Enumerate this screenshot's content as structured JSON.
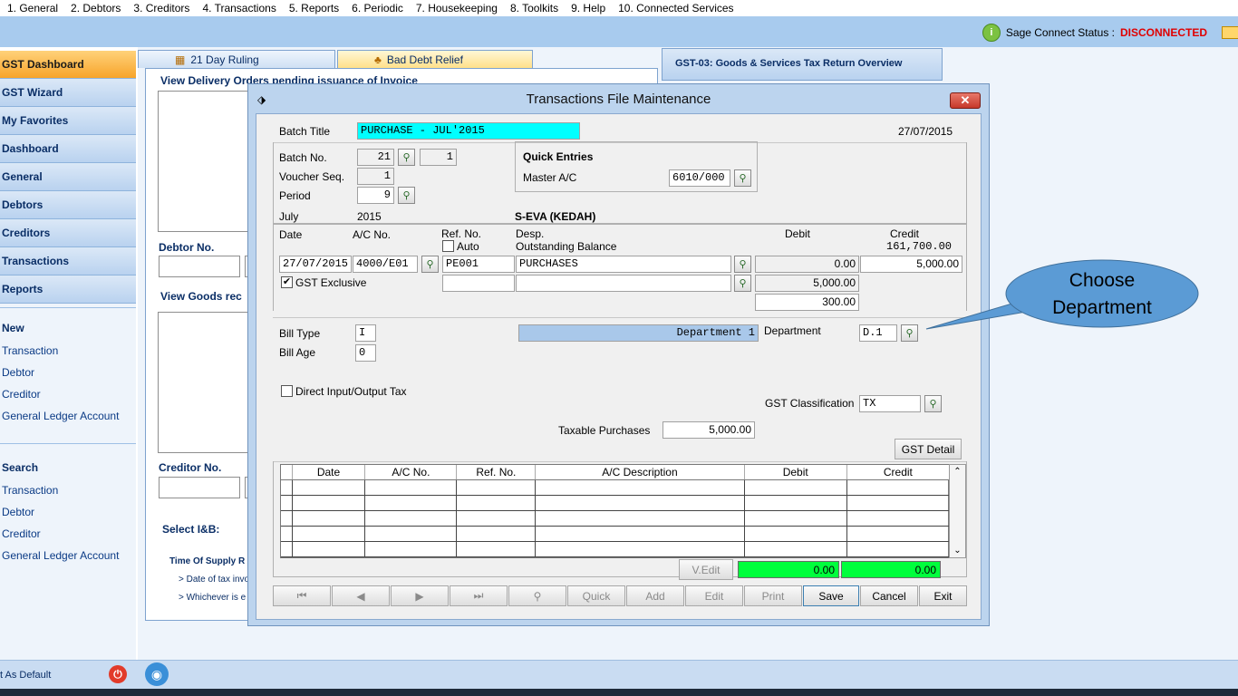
{
  "menu": [
    "1. General",
    "2. Debtors",
    "3. Creditors",
    "4. Transactions",
    "5. Reports",
    "6. Periodic",
    "7. Housekeeping",
    "8. Toolkits",
    "9. Help",
    "10. Connected Services"
  ],
  "connect": {
    "label": "Sage Connect Status :",
    "status": "DISCONNECTED"
  },
  "sidebar": {
    "buttons": [
      "GST Dashboard",
      "GST Wizard",
      "My Favorites",
      "Dashboard",
      "General",
      "Debtors",
      "Creditors",
      "Transactions",
      "Reports"
    ],
    "new_heading": "New",
    "new_links": [
      "Transaction",
      "Debtor",
      "Creditor",
      "General Ledger Account"
    ],
    "search_heading": "Search",
    "search_links": [
      "Transaction",
      "Debtor",
      "Creditor",
      "General Ledger Account"
    ],
    "set_default": "t As Default"
  },
  "background": {
    "tab1": "21 Day Ruling",
    "tab2": "Bad Debt Relief",
    "gst_box": "GST-03: Goods & Services Tax Return Overview",
    "delivery_title": "View Delivery Orders pending issuance of Invoice",
    "debtor_no": "Debtor No.",
    "goods_title": "View Goods rec",
    "creditor_no": "Creditor No.",
    "select_ib": "Select I&B:",
    "time_supply": "Time Of Supply R",
    "bullet1": "> Date of tax invo",
    "bullet2": "> Whichever is e"
  },
  "dialog": {
    "title": "Transactions File Maintenance",
    "close": "✕",
    "batch_title_label": "Batch Title",
    "batch_title": "PURCHASE - JUL'2015",
    "date_top": "27/07/2015",
    "batch_no_label": "Batch No.",
    "batch_no": "21",
    "batch_no2": "1",
    "voucher_label": "Voucher Seq.",
    "voucher": "1",
    "period_label": "Period",
    "period": "9",
    "quick_entries": "Quick Entries",
    "master_ac_label": "Master A/C",
    "master_ac": "6010/000",
    "month": "July",
    "year": "2015",
    "company": "S-EVA (KEDAH)",
    "col_date": "Date",
    "col_ac": "A/C No.",
    "col_ref": "Ref. No.",
    "col_auto": "Auto",
    "col_desp": "Desp.",
    "col_outstanding": "Outstanding Balance",
    "col_debit": "Debit",
    "col_credit": "Credit",
    "outstanding_value": "161,700.00",
    "row_date": "27/07/2015",
    "row_ac": "4000/E01",
    "row_ref": "PE001",
    "row_desp": "PURCHASES",
    "row_debit": "0.00",
    "row_credit": "5,000.00",
    "gst_exclusive": "GST Exclusive",
    "amount1": "5,000.00",
    "amount2": "300.00",
    "bill_type_label": "Bill Type",
    "bill_type": "I",
    "bill_age_label": "Bill Age",
    "bill_age": "0",
    "department_name": "Department 1",
    "department_label": "Department",
    "department_code": "D.1",
    "direct_io": "Direct Input/Output Tax",
    "gst_class_label": "GST Classification",
    "gst_class": "TX",
    "taxable_label": "Taxable Purchases",
    "taxable": "5,000.00",
    "gst_detail": "GST Detail",
    "grid_headers": [
      "Date",
      "A/C No.",
      "Ref. No.",
      "A/C Description",
      "Debit",
      "Credit"
    ],
    "vedit": "V.Edit",
    "total_debit": "0.00",
    "total_credit": "0.00",
    "buttons": {
      "quick": "Quick",
      "add": "Add",
      "edit": "Edit",
      "print": "Print",
      "save": "Save",
      "cancel": "Cancel",
      "exit": "Exit"
    }
  },
  "callout": {
    "line1": "Choose",
    "line2": "Department"
  },
  "colors": {
    "accent": "#a8cbee",
    "cyan": "#00ffff",
    "green": "#00ff3c",
    "callout": "#5b9bd5",
    "error": "#e00000"
  }
}
